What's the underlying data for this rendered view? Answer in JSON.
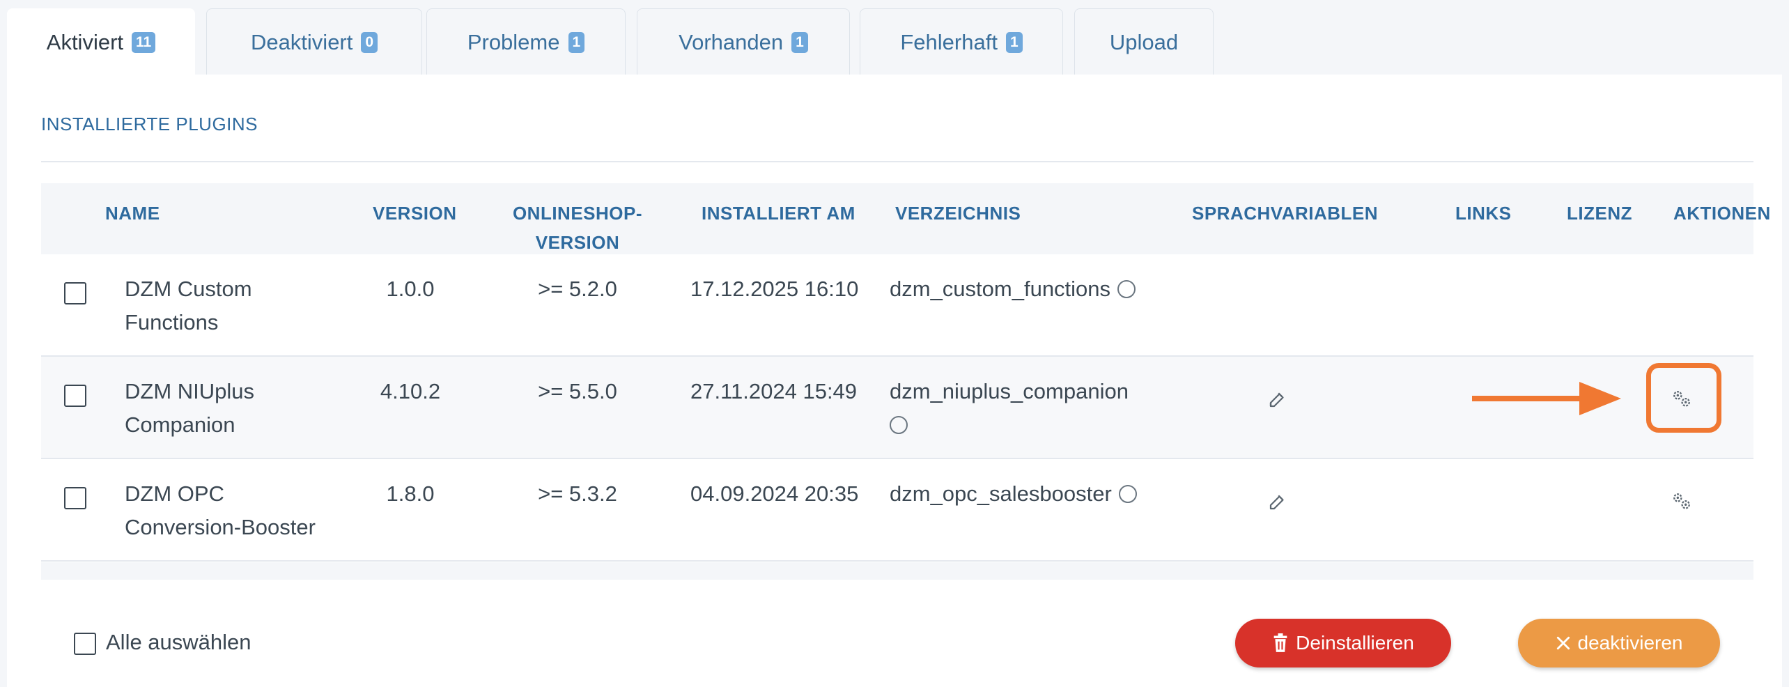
{
  "tabs": [
    {
      "label": "Aktiviert",
      "badge": "11"
    },
    {
      "label": "Deaktiviert",
      "badge": "0"
    },
    {
      "label": "Probleme",
      "badge": "1"
    },
    {
      "label": "Vorhanden",
      "badge": "1"
    },
    {
      "label": "Fehlerhaft",
      "badge": "1"
    },
    {
      "label": "Upload",
      "badge": ""
    }
  ],
  "section_title": "INSTALLIERTE PLUGINS",
  "columns": {
    "name": "NAME",
    "version": "VERSION",
    "shop_version_1": "ONLINESHOP-",
    "shop_version_2": "VERSION",
    "installed": "INSTALLIERT AM",
    "directory": "VERZEICHNIS",
    "lang_vars": "SPRACHVARIABLEN",
    "links": "LINKS",
    "license": "LIZENZ",
    "actions": "AKTIONEN"
  },
  "rows": [
    {
      "name_1": "DZM Custom",
      "name_2": "Functions",
      "version": "1.0.0",
      "shop_version": ">= 5.2.0",
      "installed": "17.12.2025 16:10",
      "directory": "dzm_custom_functions",
      "lang_edit": false,
      "settings": false
    },
    {
      "name_1": "DZM NIUplus",
      "name_2": "Companion",
      "version": "4.10.2",
      "shop_version": ">= 5.5.0",
      "installed": "27.11.2024 15:49",
      "directory": "dzm_niuplus_companion",
      "lang_edit": true,
      "settings": true
    },
    {
      "name_1": "DZM OPC",
      "name_2": "Conversion-Booster",
      "version": "1.8.0",
      "shop_version": ">= 5.3.2",
      "installed": "04.09.2024 20:35",
      "directory": "dzm_opc_salesbooster",
      "lang_edit": true,
      "settings": true
    }
  ],
  "footer": {
    "select_all": "Alle auswählen",
    "uninstall": "Deinstallieren",
    "deactivate": "deaktivieren"
  },
  "colors": {
    "accent": "#2e6a9e",
    "badge": "#6fa8dc",
    "uninstall": "#d8322a",
    "deactivate": "#ec9a45",
    "highlight": "#f07832"
  }
}
